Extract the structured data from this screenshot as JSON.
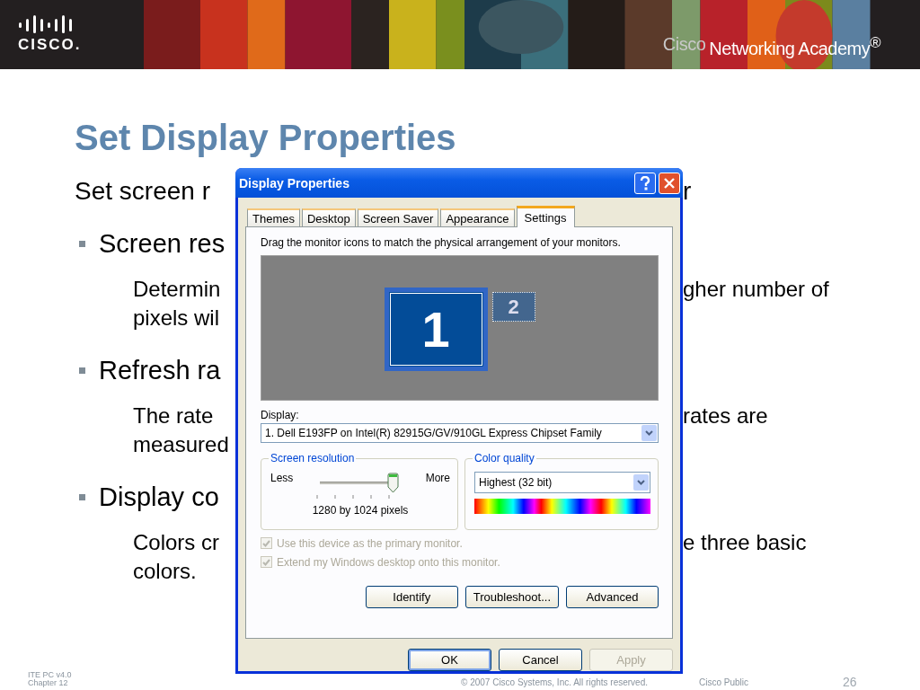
{
  "header": {
    "logo": "CISCO.",
    "academy_prefix": "Cisco",
    "academy_name": "Networking Academy$^{®}$"
  },
  "slide": {
    "title": "Set Display Properties",
    "lines": [
      {
        "kind": "lead",
        "left": "Set screen r",
        "right": "r"
      },
      {
        "kind": "bullet",
        "left": "Screen res"
      },
      {
        "kind": "sub",
        "left": "Determin",
        "right": "gher number of"
      },
      {
        "kind": "cont",
        "left": "pixels wil"
      },
      {
        "kind": "bullet",
        "left": "Refresh ra"
      },
      {
        "kind": "sub",
        "left": "The rate",
        "right": "rates are"
      },
      {
        "kind": "cont",
        "left": "measured"
      },
      {
        "kind": "bullet",
        "left": "Display co"
      },
      {
        "kind": "sub",
        "left": "Colors cr",
        "right": "e three basic"
      },
      {
        "kind": "cont",
        "left": "colors."
      }
    ]
  },
  "dialog": {
    "title": "Display Properties",
    "tabs": [
      {
        "label": "Themes",
        "selected": false
      },
      {
        "label": "Desktop",
        "selected": false
      },
      {
        "label": "Screen Saver",
        "selected": false
      },
      {
        "label": "Appearance",
        "selected": false
      },
      {
        "label": "Settings",
        "selected": true
      }
    ],
    "instruction": "Drag the monitor icons to match the physical arrangement of your monitors.",
    "monitors": [
      {
        "label": "1",
        "selected": true
      },
      {
        "label": "2",
        "selected": false
      }
    ],
    "display_label": "Display:",
    "display_value": "1. Dell E193FP on Intel(R) 82915G/GV/910GL Express Chipset Family",
    "resolution": {
      "title": "Screen resolution",
      "less": "Less",
      "more": "More",
      "level": 1,
      "reading": "1280 by 1024 pixels"
    },
    "color_quality": {
      "title": "Color quality",
      "value": "Highest (32 bit)"
    },
    "checkboxes": [
      {
        "label": "Use this device as the primary monitor.",
        "checked": true,
        "disabled": true
      },
      {
        "label": "Extend my Windows desktop onto this monitor.",
        "checked": true,
        "disabled": true
      }
    ],
    "actions": [
      "Identify",
      "Troubleshoot...",
      "Advanced"
    ],
    "buttons": [
      {
        "label": "OK",
        "default": true,
        "disabled": false
      },
      {
        "label": "Cancel",
        "default": false,
        "disabled": false
      },
      {
        "label": "Apply",
        "default": false,
        "disabled": true
      }
    ]
  },
  "footer": {
    "course": "ITE PC v4.0",
    "chapter": "Chapter 12",
    "copyright": "© 2007 Cisco Systems, Inc. All rights reserved.",
    "classification": "Cisco Public",
    "page": "26"
  }
}
